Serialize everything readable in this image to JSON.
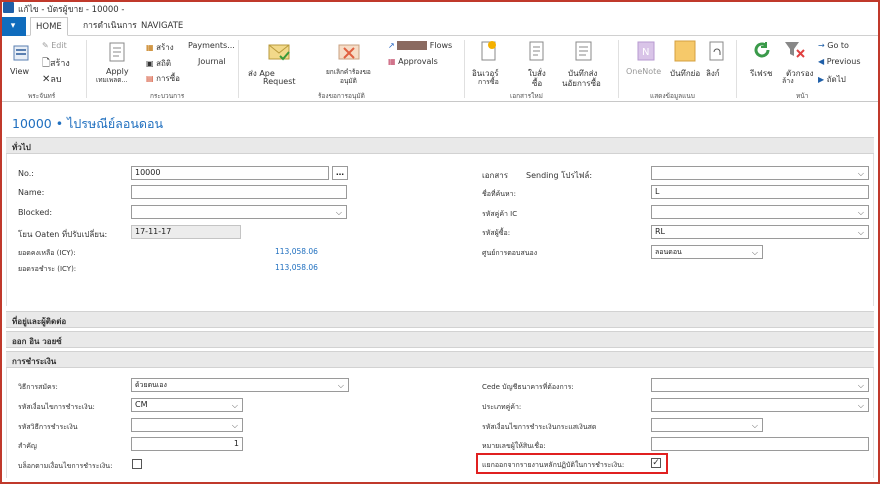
{
  "window": {
    "title": "แก้ไข - บัตรผู้ขาย -      10000 -"
  },
  "ribbon_tabs": {
    "file": "▾",
    "home": "HOME",
    "actions": "การดำเนินการ",
    "navigate": "NAVIGATE"
  },
  "ribbon": {
    "view": "View",
    "edit": "Edit",
    "new": "สร้าง",
    "delete": "ลบ",
    "apply": "Apply",
    "apply_sub": "เทมเพลต...",
    "create": "สร้าง",
    "payments": "Payments...",
    "list": "สถิติ",
    "journal": "Journal",
    "order": "การซื้อ",
    "send_approval": "ส่ง Ape",
    "send_approval2": "Request",
    "cancel_approval": "ยกเลิกคำร้องขอ",
    "cancel_approval2": "อนุมัติ",
    "flows": "Flows",
    "approvals": "Approvals",
    "attach1": "อินเวอร์",
    "attach1b": "การซื้อ",
    "attach2": "ใบสั่ง",
    "attach2b": "ซื้อ",
    "attach3": "บันทึกส่ง",
    "attach3b": "นอัยการซื้อ",
    "onenote": "OneNote",
    "notes": "บันทึกย่อ",
    "links": "ลิงก์",
    "refresh": "รีเฟรช",
    "filter": "ตัวกรอง",
    "clear": "ล้าง",
    "goto": "Go to",
    "previous": "Previous",
    "next": "ถัดไป"
  },
  "group_labels": {
    "g1": "พระจันทร์",
    "g2": "กระบวนการ",
    "g3": "ร้องขอการอนุมัติ",
    "g4": "เอกสารใหม่",
    "g5": "แสดงข้อมูลแนบ",
    "g6": "หน้า"
  },
  "page": {
    "title": "10000 • ไปรษณีย์ลอนดอน"
  },
  "sections": {
    "general": "ทั่วไป",
    "address": "ที่อยู่และผู้ติดต่อ",
    "invoicing": "ออก อิน วอยซ์",
    "payments": "การชำระเงิน"
  },
  "general": {
    "no_label": "No.:",
    "no_value": "10000",
    "name_label": "Name:",
    "name_value": "",
    "blocked_label": "Blocked:",
    "blocked_value": "",
    "last_modified_label": "โยน Oaten ที่ปรับเปลี่ยน:",
    "last_modified_value": "17-11-17",
    "balance_label": "ยอดคงเหลือ (ICY):",
    "balance_value": "113,058.06",
    "due_label": "ยอดรอชำระ (ICY):",
    "due_value": "113,058.06",
    "doc_label": "เอกสาร",
    "sending_label": "Sending โปรไฟล์:",
    "sending_value": "",
    "search_name_label": "ชื่อที่ค้นหา:",
    "search_name_value": "L",
    "ic_partner_label": "รหัสคู่ค้า IC",
    "ic_partner_value": "",
    "purchaser_label": "รหัสผู้ซื้อ:",
    "purchaser_value": "RL",
    "resp_center_label": "ศูนย์การตอบสนอง",
    "resp_center_value": "ลอนดอน"
  },
  "payments": {
    "method_label": "วิธีการสมัคร:",
    "method_value": "ด้วยตนเอง",
    "pay_code_label": "รหัสเงื่อนไขการชำระเงิน:",
    "pay_code_value": "CM",
    "pay_method_label": "รหัสวิธีการชำระเงิน",
    "pay_method_value": "",
    "priority_label": "สำคัญ",
    "priority_value": "1",
    "block_label": "บล็อกตามเงื่อนไขการชำระเงิน:",
    "cede_label": "Cede บัญชีธนาคารที่ต้องการ:",
    "cede_value": "",
    "partner_type_label": "ประเภทคู่ค้า:",
    "partner_type_value": "",
    "cash_flow_label": "รหัสเงื่อนไขการชำระเงินกระแสเงินสด",
    "cash_flow_value": "",
    "creditor_label": "หมายเลขผู้ให้สินเชื่อ:",
    "creditor_value": "",
    "exclude_label": "แยกออกจากรายงานหลักปฏิบัติในการชำระเงิน:",
    "exclude_checked": "✓"
  },
  "colors": {
    "accent": "#0f6cbd",
    "highlight": "#e02020",
    "link": "#1f6fbf"
  }
}
